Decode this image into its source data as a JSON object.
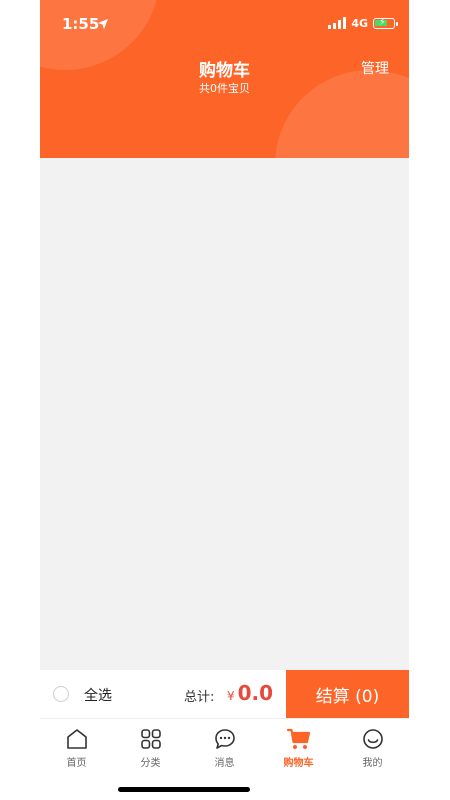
{
  "status": {
    "time": "1:55",
    "network": "4G"
  },
  "header": {
    "title": "购物车",
    "subtitle": "共0件宝贝",
    "manage_label": "管理"
  },
  "checkout": {
    "select_all_label": "全选",
    "total_label": "总计:",
    "currency": "¥",
    "total_amount": "0.0",
    "checkout_button_label": "结算 (0)"
  },
  "tabbar": {
    "items": [
      {
        "label": "首页",
        "icon": "home-icon"
      },
      {
        "label": "分类",
        "icon": "grid-icon"
      },
      {
        "label": "消息",
        "icon": "chat-icon"
      },
      {
        "label": "购物车",
        "icon": "cart-icon",
        "active": true
      },
      {
        "label": "我的",
        "icon": "smiley-icon"
      }
    ]
  },
  "colors": {
    "accent": "#fd6428",
    "price": "#e64a3d",
    "background": "#f2f2f2"
  }
}
